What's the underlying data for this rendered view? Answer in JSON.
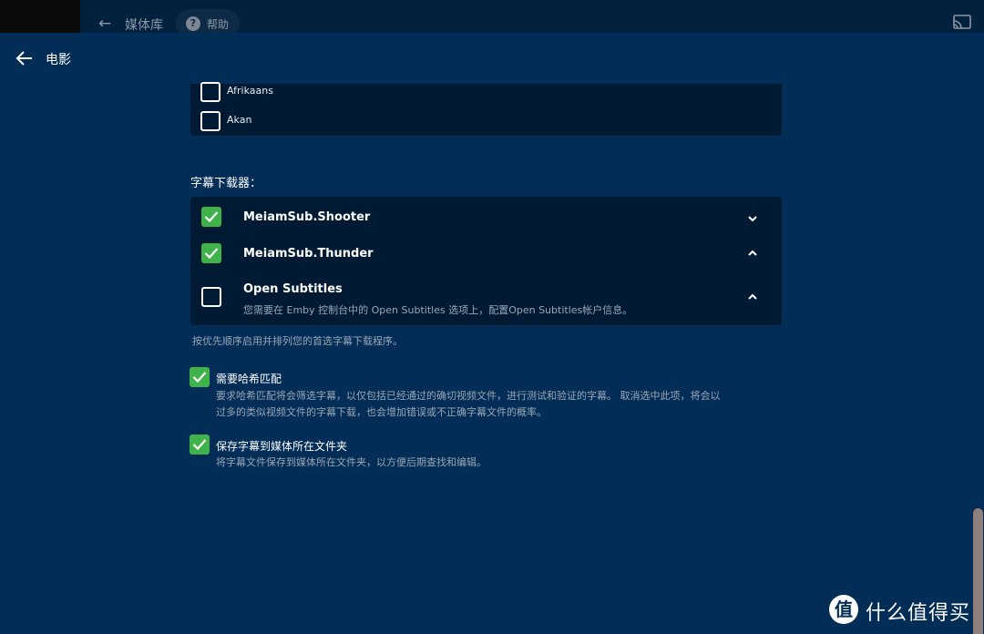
{
  "background_bar": {
    "back_icon": "arrow-left-icon",
    "title": "媒体库",
    "help_label": "帮助",
    "help_icon": "question-circle-icon",
    "cast_icon": "cast-icon"
  },
  "header": {
    "back_icon": "arrow-left-icon",
    "title": "电影"
  },
  "languages": [
    {
      "label": "Afrikaans",
      "checked": false
    },
    {
      "label": "Akan",
      "checked": false
    }
  ],
  "downloaders": {
    "title": "字幕下载器：",
    "items": [
      {
        "name": "MeiamSub.Shooter",
        "checked": true,
        "chevron": "chevron-down-icon",
        "desc": ""
      },
      {
        "name": "MeiamSub.Thunder",
        "checked": true,
        "chevron": "chevron-up-icon",
        "desc": ""
      },
      {
        "name": "Open Subtitles",
        "checked": false,
        "chevron": "chevron-up-icon",
        "desc": "您需要在 Emby 控制台中的 Open Subtitles 选项上，配置Open Subtitles帐户信息。"
      }
    ],
    "helper": "按优先顺序启用并排列您的首选字幕下载程序。"
  },
  "options": {
    "hash_match": {
      "label": "需要哈希匹配",
      "checked": true,
      "desc_line1": "要求哈希匹配将会筛选字幕，以仅包括已经通过的确切视频文件，进行测试和验证的字幕。 取消选中此项，将会以",
      "desc_line2": "过多的类似视频文件的字幕下载，也会增加错误或不正确字幕文件的概率。"
    },
    "save_with_media": {
      "label": "保存字幕到媒体所在文件夹",
      "checked": true,
      "desc": "将字幕文件保存到媒体所在文件夹，以方便后期查找和编辑。"
    }
  },
  "watermark": {
    "logo_glyph": "值",
    "text": "什么值得买"
  },
  "colors": {
    "background": "#022d57",
    "panel": "#011a33",
    "check_green": "#3fb34a"
  }
}
